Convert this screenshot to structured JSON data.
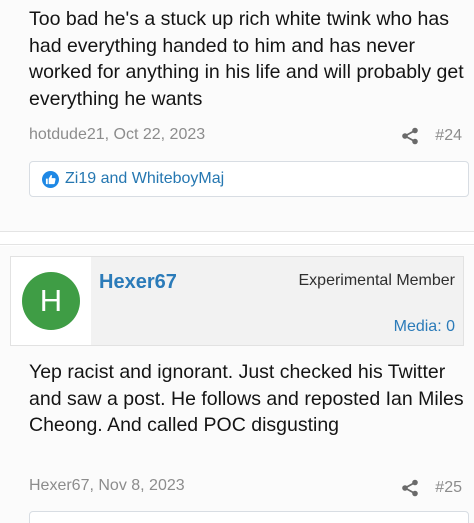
{
  "posts": [
    {
      "body": "Too bad he's a stuck up rich white twink who has had everything handed to him and has never worked for anything in his life and will probably get everything he wants",
      "author_date": "hotdude21, Oct 22, 2023",
      "post_number": "#24",
      "reactions": "Zi19 and WhiteboyMaj"
    },
    {
      "username": "Hexer67",
      "avatar_letter": "H",
      "user_title": "Experimental Member",
      "media": "Media: 0",
      "body": "Yep racist and ignorant. Just checked his Twitter and saw a post. He follows and reposted Ian Miles Cheong. And called POC disgusting",
      "author_date": "Hexer67, Nov 8, 2023",
      "post_number": "#25"
    }
  ],
  "colors": {
    "link": "#2b7bb9",
    "avatar_bg": "#3f9d45",
    "meta_text": "#8c8c8c",
    "like_icon": "#1e88e5"
  },
  "icons": [
    "share-icon",
    "like-icon"
  ]
}
